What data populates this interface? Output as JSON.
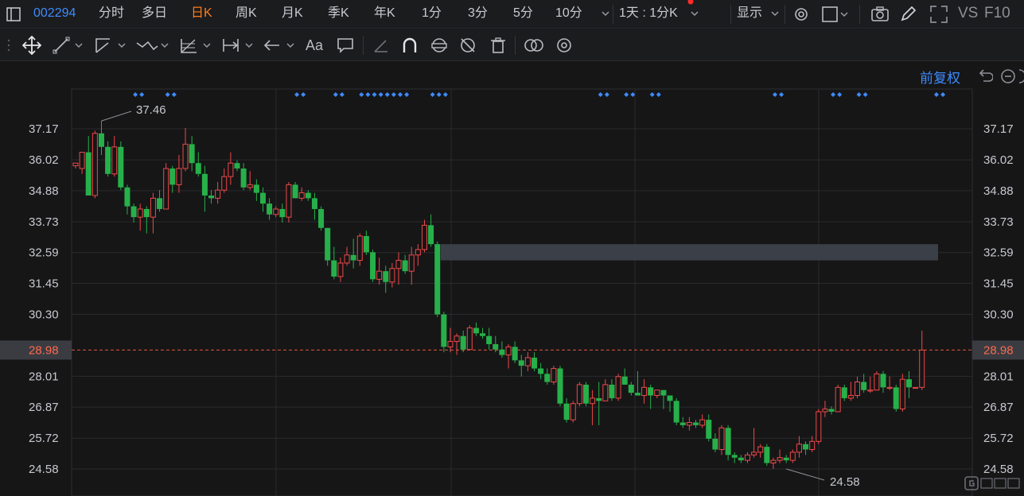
{
  "toolbar": {
    "stock_code": "002294",
    "periods": [
      {
        "label": "分时",
        "active": false
      },
      {
        "label": "多日",
        "active": false
      },
      {
        "label": "日K",
        "active": true
      },
      {
        "label": "周K",
        "active": false
      },
      {
        "label": "月K",
        "active": false
      },
      {
        "label": "季K",
        "active": false
      },
      {
        "label": "年K",
        "active": false
      },
      {
        "label": "1分",
        "active": false
      },
      {
        "label": "3分",
        "active": false
      },
      {
        "label": "5分",
        "active": false
      },
      {
        "label": "10分",
        "active": false
      }
    ],
    "range_label": "1天 : 1分K",
    "display_label": "显示",
    "vs_label": "VS",
    "f10_label": "F10"
  },
  "chart_header": {
    "adjust_label": "前复权"
  },
  "chart_data": {
    "type": "candlestick",
    "y_ticks": [
      "37.17",
      "36.02",
      "34.88",
      "33.73",
      "32.59",
      "31.45",
      "30.30",
      "28.01",
      "26.87",
      "25.72",
      "24.58"
    ],
    "ylim": [
      24.2,
      38.5
    ],
    "current_price": "28.98",
    "high_label": "37.46",
    "low_label": "24.58",
    "colors": {
      "up": "#f04848",
      "down": "#27b04a",
      "current_line": "#e5533d",
      "zone": "#3b3f48",
      "marker": "#3d8bff"
    },
    "candles": [
      [
        35.8,
        35.9,
        35.7,
        35.9
      ],
      [
        35.7,
        36.3,
        36.3,
        35.5
      ],
      [
        36.3,
        34.7,
        36.9,
        34.7
      ],
      [
        34.7,
        37.0,
        37.1,
        34.6
      ],
      [
        37.0,
        36.5,
        37.46,
        36.2
      ],
      [
        36.5,
        35.5,
        36.7,
        35.4
      ],
      [
        35.5,
        36.5,
        36.9,
        35.4
      ],
      [
        36.5,
        35.0,
        36.7,
        34.9
      ],
      [
        35.0,
        34.3,
        35.1,
        34.0
      ],
      [
        34.3,
        33.9,
        34.4,
        33.7
      ],
      [
        33.9,
        34.2,
        34.4,
        33.4
      ],
      [
        34.2,
        33.9,
        34.3,
        33.3
      ],
      [
        33.9,
        34.6,
        34.8,
        33.3
      ],
      [
        34.6,
        34.2,
        34.9,
        34.1
      ],
      [
        34.2,
        35.7,
        35.9,
        34.2
      ],
      [
        35.7,
        35.1,
        35.8,
        34.8
      ],
      [
        35.1,
        35.7,
        36.2,
        34.8
      ],
      [
        35.7,
        36.6,
        37.2,
        35.6
      ],
      [
        36.6,
        35.9,
        36.9,
        35.6
      ],
      [
        35.9,
        35.5,
        36.3,
        35.4
      ],
      [
        35.5,
        34.7,
        35.8,
        34.1
      ],
      [
        34.7,
        34.6,
        34.9,
        34.4
      ],
      [
        34.6,
        34.9,
        35.2,
        34.4
      ],
      [
        34.9,
        35.4,
        35.7,
        34.8
      ],
      [
        35.4,
        35.9,
        36.3,
        35.1
      ],
      [
        35.9,
        35.7,
        36.0,
        35.6
      ],
      [
        35.7,
        35.0,
        35.9,
        34.9
      ],
      [
        35.0,
        35.1,
        35.6,
        34.9
      ],
      [
        35.1,
        34.8,
        35.3,
        34.5
      ],
      [
        34.8,
        34.4,
        35.0,
        34.1
      ],
      [
        34.4,
        34.0,
        34.6,
        33.8
      ],
      [
        34.0,
        34.2,
        34.3,
        33.9
      ],
      [
        34.2,
        33.9,
        34.4,
        33.7
      ],
      [
        33.9,
        35.1,
        35.2,
        33.7
      ],
      [
        35.1,
        34.6,
        35.2,
        34.6
      ],
      [
        34.6,
        34.8,
        35.0,
        34.5
      ],
      [
        34.8,
        34.6,
        34.9,
        34.5
      ],
      [
        34.6,
        34.2,
        34.8,
        33.8
      ],
      [
        34.2,
        33.5,
        34.3,
        33.4
      ],
      [
        33.5,
        32.3,
        33.5,
        32.1
      ],
      [
        32.3,
        31.7,
        32.8,
        31.6
      ],
      [
        31.7,
        32.2,
        32.4,
        31.5
      ],
      [
        32.2,
        32.5,
        32.8,
        32.1
      ],
      [
        32.5,
        32.3,
        33.1,
        32.0
      ],
      [
        32.3,
        33.2,
        33.3,
        32.1
      ],
      [
        33.2,
        32.6,
        33.4,
        32.5
      ],
      [
        32.6,
        31.6,
        32.7,
        31.5
      ],
      [
        31.6,
        31.9,
        32.4,
        31.4
      ],
      [
        31.9,
        31.5,
        32.1,
        31.1
      ],
      [
        31.5,
        32.0,
        32.2,
        31.3
      ],
      [
        32.0,
        32.3,
        32.6,
        31.4
      ],
      [
        32.3,
        31.9,
        32.5,
        31.8
      ],
      [
        31.9,
        32.5,
        32.8,
        31.4
      ],
      [
        32.5,
        32.7,
        32.9,
        32.1
      ],
      [
        32.7,
        33.6,
        33.8,
        32.6
      ],
      [
        33.6,
        32.9,
        34.0,
        32.8
      ],
      [
        32.9,
        30.3,
        33.0,
        30.2
      ],
      [
        30.3,
        29.1,
        30.4,
        28.9
      ],
      [
        29.1,
        29.3,
        29.8,
        28.9
      ],
      [
        29.3,
        29.5,
        29.6,
        28.8
      ],
      [
        29.5,
        29.0,
        29.7,
        28.9
      ],
      [
        29.0,
        29.8,
        29.9,
        29.0
      ],
      [
        29.8,
        29.6,
        30.0,
        29.5
      ],
      [
        29.6,
        29.5,
        29.8,
        29.4
      ],
      [
        29.5,
        29.2,
        29.8,
        29.0
      ],
      [
        29.2,
        29.0,
        29.5,
        28.9
      ],
      [
        29.0,
        28.8,
        29.3,
        28.7
      ],
      [
        28.8,
        29.1,
        29.2,
        28.3
      ],
      [
        29.1,
        28.6,
        29.3,
        28.5
      ],
      [
        28.6,
        28.4,
        28.8,
        28.0
      ],
      [
        28.4,
        28.7,
        28.9,
        28.2
      ],
      [
        28.7,
        28.3,
        28.9,
        28.2
      ],
      [
        28.3,
        28.1,
        28.5,
        27.9
      ],
      [
        28.1,
        27.8,
        28.3,
        27.7
      ],
      [
        27.8,
        28.3,
        28.4,
        27.7
      ],
      [
        28.3,
        27.0,
        28.4,
        26.9
      ],
      [
        27.0,
        26.4,
        27.2,
        26.3
      ],
      [
        26.4,
        27.0,
        27.1,
        26.3
      ],
      [
        27.0,
        27.7,
        27.8,
        26.9
      ],
      [
        27.7,
        27.0,
        27.8,
        26.9
      ],
      [
        27.0,
        27.2,
        27.5,
        26.2
      ],
      [
        27.2,
        27.1,
        27.8,
        26.2
      ],
      [
        27.1,
        27.7,
        27.9,
        27.1
      ],
      [
        27.7,
        27.2,
        27.9,
        27.1
      ],
      [
        27.2,
        28.0,
        28.1,
        27.1
      ],
      [
        28.0,
        27.7,
        28.3,
        27.7
      ],
      [
        27.7,
        27.4,
        27.8,
        27.3
      ],
      [
        27.4,
        27.3,
        28.2,
        27.3
      ],
      [
        27.3,
        27.6,
        27.9,
        27.0
      ],
      [
        27.6,
        27.3,
        27.7,
        26.8
      ],
      [
        27.3,
        27.5,
        27.5,
        27.2
      ],
      [
        27.5,
        27.3,
        27.5,
        26.8
      ],
      [
        27.3,
        27.1,
        27.3,
        26.7
      ],
      [
        27.1,
        26.3,
        27.2,
        26.2
      ],
      [
        26.3,
        26.2,
        26.5,
        26.1
      ],
      [
        26.2,
        26.3,
        26.5,
        26.0
      ],
      [
        26.3,
        26.2,
        26.4,
        26.1
      ],
      [
        26.2,
        26.4,
        26.6,
        26.1
      ],
      [
        26.4,
        25.7,
        26.6,
        25.6
      ],
      [
        25.7,
        25.3,
        25.9,
        25.2
      ],
      [
        25.3,
        26.1,
        26.2,
        25.1
      ],
      [
        26.1,
        25.1,
        26.2,
        24.9
      ],
      [
        25.1,
        25.0,
        25.2,
        24.8
      ],
      [
        25.0,
        24.9,
        25.1,
        24.8
      ],
      [
        24.9,
        25.1,
        25.2,
        24.8
      ],
      [
        25.1,
        25.2,
        26.1,
        25.0
      ],
      [
        25.2,
        25.4,
        25.5,
        25.0
      ],
      [
        25.4,
        24.8,
        25.5,
        24.7
      ],
      [
        24.8,
        24.9,
        25.0,
        24.58
      ],
      [
        24.9,
        25.0,
        25.3,
        24.8
      ],
      [
        25.0,
        24.9,
        25.1,
        24.8
      ],
      [
        24.9,
        25.2,
        25.3,
        24.8
      ],
      [
        25.2,
        25.5,
        25.8,
        25.0
      ],
      [
        25.5,
        25.3,
        25.6,
        25.1
      ],
      [
        25.3,
        25.6,
        25.8,
        25.2
      ],
      [
        25.6,
        26.7,
        26.8,
        25.5
      ],
      [
        26.7,
        26.8,
        27.1,
        26.5
      ],
      [
        26.8,
        26.7,
        26.9,
        26.6
      ],
      [
        26.7,
        27.6,
        27.7,
        26.7
      ],
      [
        27.6,
        27.2,
        27.7,
        27.1
      ],
      [
        27.2,
        27.3,
        27.8,
        27.1
      ],
      [
        27.3,
        27.8,
        28.0,
        27.2
      ],
      [
        27.8,
        27.5,
        28.1,
        27.4
      ],
      [
        27.5,
        27.5,
        28.0,
        27.4
      ],
      [
        27.5,
        28.1,
        28.2,
        27.5
      ],
      [
        28.1,
        27.6,
        28.2,
        27.4
      ],
      [
        27.6,
        27.6,
        28.0,
        27.5
      ],
      [
        27.6,
        26.8,
        27.7,
        26.7
      ],
      [
        26.8,
        27.9,
        28.1,
        26.7
      ],
      [
        27.9,
        27.6,
        28.2,
        27.2
      ],
      [
        27.6,
        27.6,
        27.6,
        27.6
      ],
      [
        27.6,
        28.98,
        29.7,
        27.5
      ]
    ],
    "signal_groups": [
      {
        "idx": [
          9,
          10
        ]
      },
      {
        "idx": [
          14,
          15
        ]
      },
      {
        "idx": [
          34,
          35
        ]
      },
      {
        "idx": [
          40,
          41
        ]
      },
      {
        "idx": [
          44,
          45,
          46,
          47,
          48,
          49,
          50,
          51
        ]
      },
      {
        "idx": [
          55,
          56,
          57
        ]
      },
      {
        "idx": [
          81,
          82
        ]
      },
      {
        "idx": [
          85,
          86
        ]
      },
      {
        "idx": [
          89,
          90
        ]
      },
      {
        "idx": [
          108,
          109
        ]
      },
      {
        "idx": [
          117,
          118
        ]
      },
      {
        "idx": [
          121,
          122
        ]
      },
      {
        "idx": [
          133,
          134
        ]
      }
    ],
    "zone": {
      "top": 32.9,
      "bottom": 32.3,
      "from": 57,
      "to": 133
    }
  }
}
